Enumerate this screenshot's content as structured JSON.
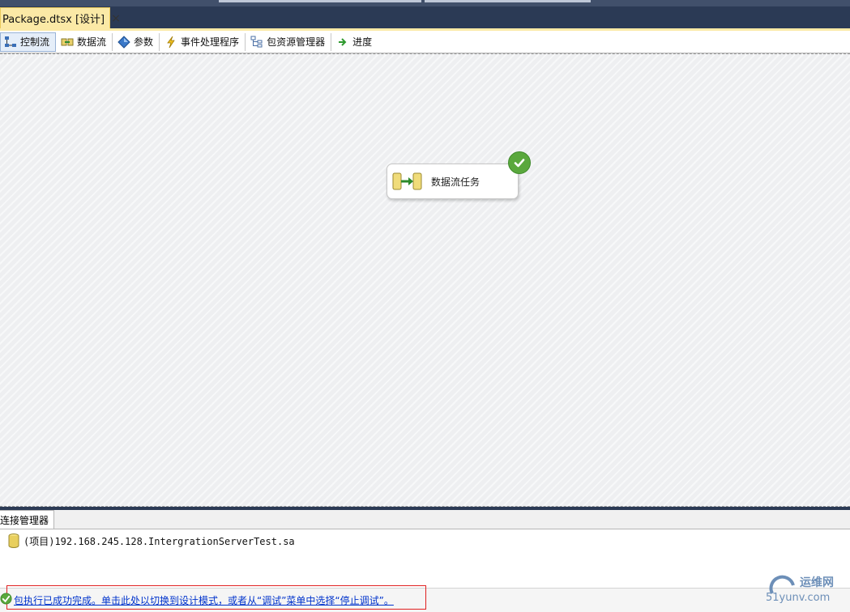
{
  "document_tab": {
    "title": "Package.dtsx [设计]",
    "close_symbol": "×"
  },
  "designer_tabs": [
    {
      "label": "控制流",
      "icon": "control-flow-icon",
      "active": true
    },
    {
      "label": "数据流",
      "icon": "data-flow-icon",
      "active": false
    },
    {
      "label": "参数",
      "icon": "parameters-icon",
      "active": false
    },
    {
      "label": "事件处理程序",
      "icon": "event-handler-icon",
      "active": false
    },
    {
      "label": "包资源管理器",
      "icon": "package-explorer-icon",
      "active": false
    },
    {
      "label": "进度",
      "icon": "progress-icon",
      "active": false
    }
  ],
  "canvas": {
    "task": {
      "label": "数据流任务",
      "icon": "data-flow-task-icon",
      "status": "success-check-icon"
    }
  },
  "connection_managers": {
    "tab_label": "连接管理器",
    "items": [
      {
        "label": "(项目)192.168.245.128.IntergrationServerTest.sa",
        "icon": "database-cylinder-icon"
      }
    ]
  },
  "status_bar": {
    "message": "包执行已成功完成。单击此处以切换到设计模式，或者从“调试”菜单中选择“停止调试”。",
    "icon": "success-check-icon"
  },
  "watermark": {
    "text": "运维网",
    "url": "51yunv.com"
  },
  "colors": {
    "tab_active": "#fbe9a6",
    "window_frame": "#2b3a55",
    "success": "#5aa83d",
    "link": "#0033cc",
    "highlight_box": "#e02020"
  }
}
